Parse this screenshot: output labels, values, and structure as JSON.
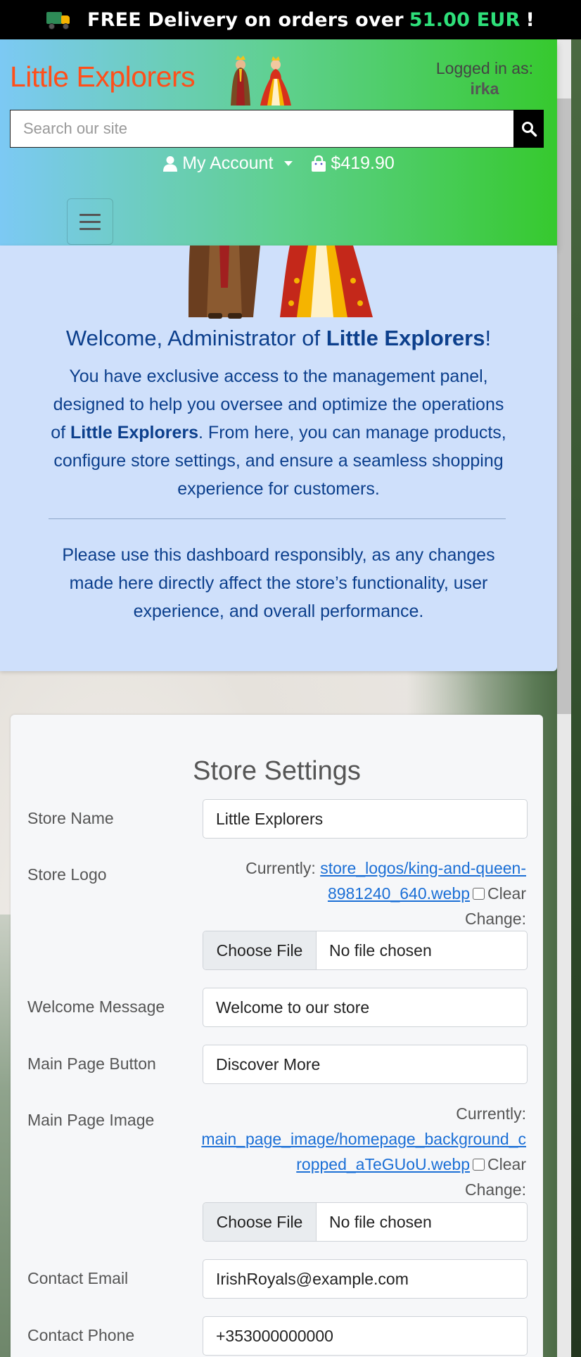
{
  "promo": {
    "icon": "delivery-truck-icon",
    "text_before": "FREE Delivery on orders over",
    "amount": "51.00 EUR",
    "text_after": "!"
  },
  "header": {
    "brand": "Little Explorers",
    "logged_in_label": "Logged in as:",
    "username": "irka",
    "search": {
      "placeholder": "Search our site"
    },
    "account_label": "My Account",
    "cart_total": "$419.90"
  },
  "welcome": {
    "heading_pre": "Welcome, Administrator of ",
    "heading_store": "Little Explorers",
    "heading_post": "!",
    "p1_pre": "You have exclusive access to the management panel, designed to help you oversee and optimize the operations of ",
    "p1_store": "Little Explorers",
    "p1_post": ". From here, you can manage products, configure store settings, and ensure a seamless shopping experience for customers.",
    "p2": "Please use this dashboard responsibly, as any changes made here directly affect the store’s functionality, user experience, and overall performance."
  },
  "settings": {
    "title": "Store Settings",
    "store_name": {
      "label": "Store Name",
      "value": "Little Explorers"
    },
    "store_logo": {
      "label": "Store Logo",
      "currently": "Currently:",
      "link_line1": "store_logos/king-and-queen-",
      "link_line2": "8981240_640.webp",
      "clear": "Clear",
      "change": "Change:",
      "choose": "Choose File",
      "chosen": "No file chosen"
    },
    "welcome_message": {
      "label": "Welcome Message",
      "value": "Welcome to our store"
    },
    "main_page_button": {
      "label": "Main Page Button",
      "value": "Discover More"
    },
    "main_page_image": {
      "label": "Main Page Image",
      "currently": "Currently:",
      "link_line1": "main_page_image/homepage_background_c",
      "link_line2": "ropped_aTeGUoU.webp",
      "clear": "Clear",
      "change": "Change:",
      "choose": "Choose File",
      "chosen": "No file chosen"
    },
    "contact_email": {
      "label": "Contact Email",
      "value": "IrishRoyals@example.com"
    },
    "contact_phone": {
      "label": "Contact Phone",
      "value": "+353000000000"
    }
  },
  "colors": {
    "brand": "#ff4f1a",
    "promo_amount": "#2ee07a",
    "welcome_text": "#0c3f8c",
    "link": "#1b6fd6"
  }
}
